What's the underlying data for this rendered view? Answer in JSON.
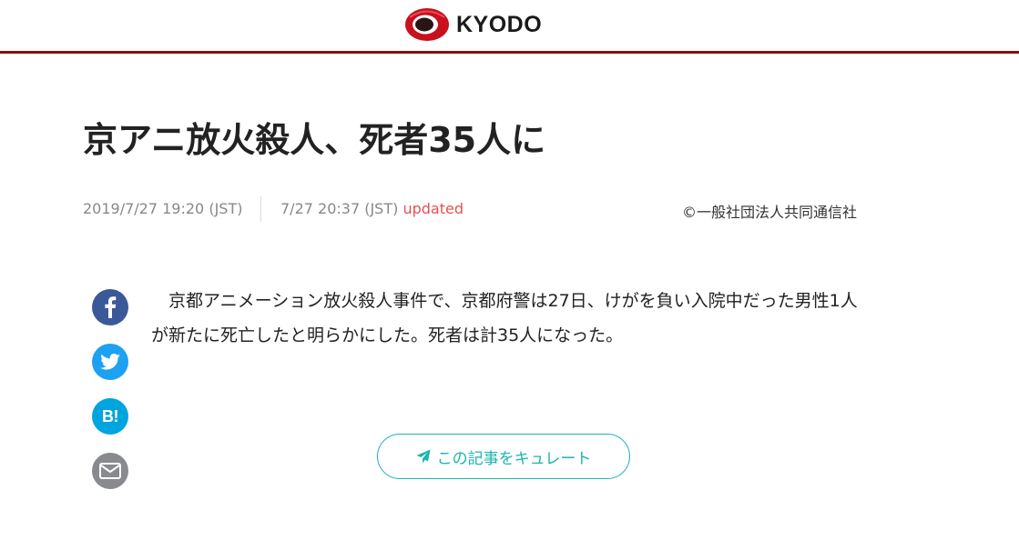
{
  "header": {
    "logo_text": "KYODO",
    "brand_color": "#8b0c12",
    "logo_mark_icon": "kyodo-logo-mark-icon"
  },
  "article": {
    "title": "京アニ放火殺人、死者35人に",
    "published": "2019/7/27 19:20 (JST)",
    "updated_time": "7/27 20:37 (JST)",
    "updated_label": "updated",
    "copyright": "©一般社団法人共同通信社",
    "body": "　京都アニメーション放火殺人事件で、京都府警は27日、けがを負い入院中だった男性1人が新たに死亡したと明らかにした。死者は計35人になった。"
  },
  "share": {
    "facebook_icon": "facebook-icon",
    "twitter_icon": "twitter-icon",
    "hatena_label": "B!",
    "mail_icon": "mail-icon",
    "colors": {
      "facebook": "#3b5998",
      "twitter": "#1da1f2",
      "hatena": "#00a4de",
      "mail": "#888a8d"
    }
  },
  "curate": {
    "label": "この記事をキュレート",
    "icon": "paper-plane-icon",
    "accent_color": "#1ab5ae"
  }
}
